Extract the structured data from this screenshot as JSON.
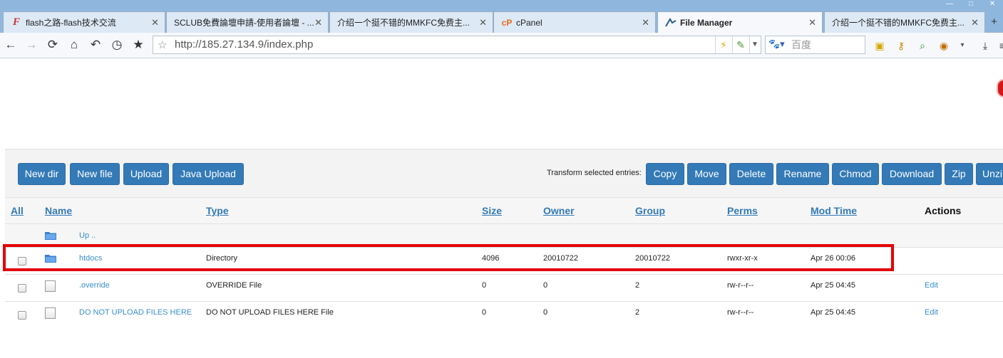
{
  "browser": {
    "tabs": [
      {
        "title": "flash之路-flash技术交流",
        "icon": "flash-favicon"
      },
      {
        "title": "SCLUB免費論壇申請-使用者論壇 - ...",
        "icon": "page-favicon"
      },
      {
        "title": "介绍一个挺不错的MMKFC免费主...",
        "icon": "page-favicon"
      },
      {
        "title": "cPanel",
        "icon": "cpanel-favicon"
      },
      {
        "title": "File Manager",
        "icon": "filemanager-favicon"
      },
      {
        "title": "介绍一个挺不错的MMKFC免费主...",
        "icon": "page-favicon"
      }
    ],
    "active_tab": "File Manager",
    "url": "http://185.27.134.9/index.php",
    "search_placeholder": "百度"
  },
  "toolbar_buttons": {
    "new_dir": "New dir",
    "new_file": "New file",
    "upload": "Upload",
    "java_upload": "Java Upload",
    "transform_label": "Transform selected entries:",
    "copy": "Copy",
    "move": "Move",
    "delete": "Delete",
    "rename": "Rename",
    "chmod": "Chmod",
    "download": "Download",
    "zip": "Zip",
    "unzip": "Unzi"
  },
  "table": {
    "headers": {
      "all": "All",
      "name": "Name",
      "type": "Type",
      "size": "Size",
      "owner": "Owner",
      "group": "Group",
      "perms": "Perms",
      "modtime": "Mod Time",
      "actions": "Actions"
    },
    "up_label": "Up ..",
    "rows": [
      {
        "name": "htdocs",
        "type": "Directory",
        "size": "4096",
        "owner": "20010722",
        "group": "20010722",
        "perms": "rwxr-xr-x",
        "modtime": "Apr 26 00:06",
        "action": ""
      },
      {
        "name": ".override",
        "type": "OVERRIDE File",
        "size": "0",
        "owner": "0",
        "group": "2",
        "perms": "rw-r--r--",
        "modtime": "Apr 25 04:45",
        "action": "Edit"
      },
      {
        "name": "DO NOT UPLOAD FILES HERE",
        "type": "DO NOT UPLOAD FILES HERE File",
        "size": "0",
        "owner": "0",
        "group": "2",
        "perms": "rw-r--r--",
        "modtime": "Apr 25 04:45",
        "action": "Edit"
      }
    ]
  },
  "colors": {
    "button": "#337ab7",
    "link": "#3a8fc8",
    "highlight": "#e30000",
    "tabbar": "#8fb7de"
  }
}
